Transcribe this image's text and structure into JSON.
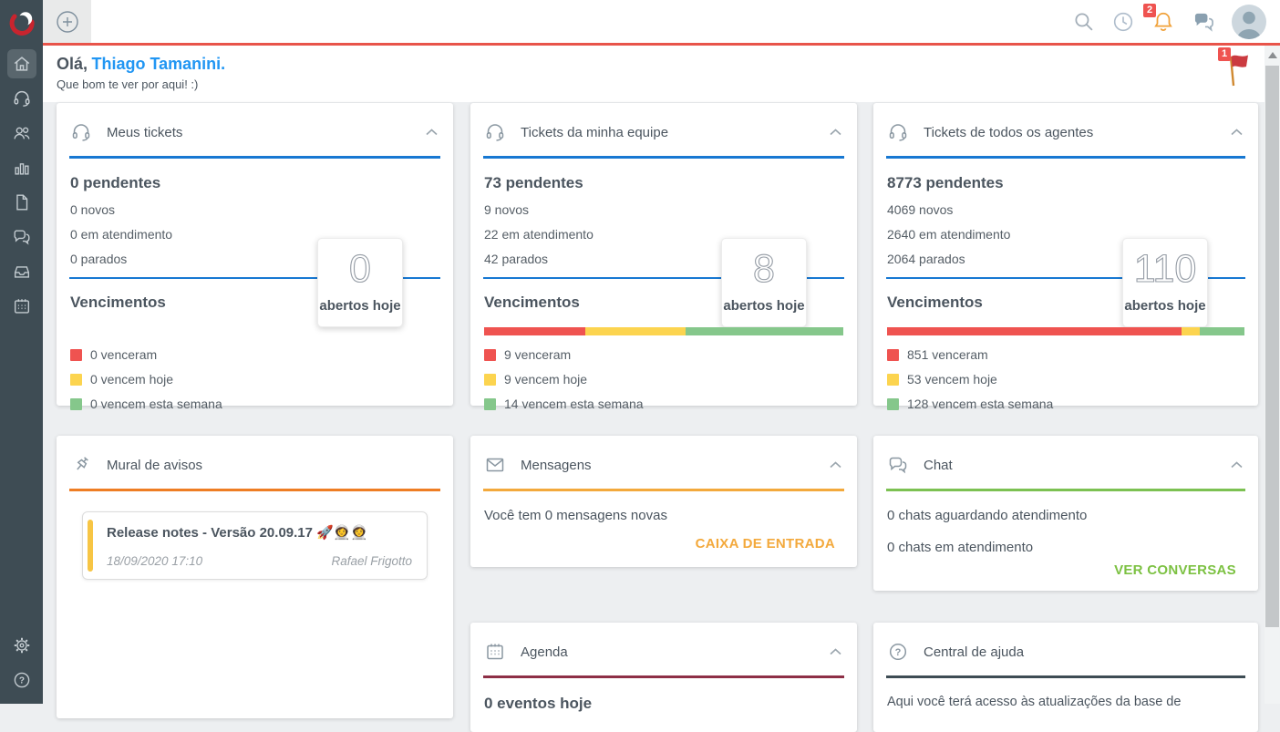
{
  "colors": {
    "accent_line": "#e8544a",
    "ticket_blue": "#1778d2",
    "mural_orange": "#ee7d23",
    "mensagens_amber": "#f3a93c",
    "chat_green": "#7cc152",
    "agenda_maroon": "#8e2f46",
    "ajuda_slate": "#3e4c54",
    "bar_red": "#ef5350",
    "bar_yellow": "#fcd44f",
    "bar_green": "#85c78b"
  },
  "icons": {
    "topbar": [
      "search-icon",
      "clock-icon",
      "bell-icon",
      "chat-icon",
      "avatar"
    ],
    "sidebar": [
      "home-icon",
      "headset-icon",
      "people-icon",
      "bar-chart-icon",
      "document-icon",
      "chat-bubbles-icon",
      "inbox-icon",
      "calendar-icon",
      "gear-icon",
      "help-icon"
    ],
    "question_glyph": "?"
  },
  "topbar": {
    "bell_badge": "2",
    "flag_badge": "1"
  },
  "greeting": {
    "hello": "Olá,",
    "name": "Thiago Tamanini.",
    "subtitle": "Que bom te ver por aqui! :)"
  },
  "tickets": [
    {
      "title": "Meus tickets",
      "accent": "#1778d2",
      "pendentes": "0 pendentes",
      "novos": "0 novos",
      "em_atendimento": "0 em atendimento",
      "parados": "0 parados",
      "abertos_value": "0",
      "abertos_label": "abertos hoje",
      "vencimentos_title": "Vencimentos",
      "bar": [
        {
          "color": "#ef5350",
          "pct": 0
        },
        {
          "color": "#fcd44f",
          "pct": 0
        },
        {
          "color": "#85c78b",
          "pct": 0
        }
      ],
      "legend": [
        {
          "color": "#ef5350",
          "label": "0 venceram"
        },
        {
          "color": "#fcd44f",
          "label": "0 vencem hoje"
        },
        {
          "color": "#85c78b",
          "label": "0 vencem esta semana"
        }
      ]
    },
    {
      "title": "Tickets da minha equipe",
      "accent": "#1778d2",
      "pendentes": "73 pendentes",
      "novos": "9 novos",
      "em_atendimento": "22 em atendimento",
      "parados": "42 parados",
      "abertos_value": "8",
      "abertos_label": "abertos hoje",
      "vencimentos_title": "Vencimentos",
      "bar": [
        {
          "color": "#ef5350",
          "pct": 28.1
        },
        {
          "color": "#fcd44f",
          "pct": 28.1
        },
        {
          "color": "#85c78b",
          "pct": 43.8
        }
      ],
      "legend": [
        {
          "color": "#ef5350",
          "label": "9 venceram"
        },
        {
          "color": "#fcd44f",
          "label": "9 vencem hoje"
        },
        {
          "color": "#85c78b",
          "label": "14 vencem esta semana"
        }
      ]
    },
    {
      "title": "Tickets de todos os agentes",
      "accent": "#1778d2",
      "pendentes": "8773 pendentes",
      "novos": "4069 novos",
      "em_atendimento": "2640 em atendimento",
      "parados": "2064 parados",
      "abertos_value": "110",
      "abertos_label": "abertos hoje",
      "vencimentos_title": "Vencimentos",
      "bar": [
        {
          "color": "#ef5350",
          "pct": 82.5
        },
        {
          "color": "#fcd44f",
          "pct": 5.1
        },
        {
          "color": "#85c78b",
          "pct": 12.4
        }
      ],
      "legend": [
        {
          "color": "#ef5350",
          "label": "851 venceram"
        },
        {
          "color": "#fcd44f",
          "label": "53 vencem hoje"
        },
        {
          "color": "#85c78b",
          "label": "128 vencem esta semana"
        }
      ]
    }
  ],
  "mural": {
    "title": "Mural de avisos",
    "accent": "#ee7d23",
    "note": {
      "title": "Release notes - Versão 20.09.17 🚀👩‍🚀👩‍🚀",
      "date": "18/09/2020 17:10",
      "author": "Rafael Frigotto"
    }
  },
  "mensagens": {
    "title": "Mensagens",
    "accent": "#f3a93c",
    "body": "Você tem 0 mensagens novas",
    "link": "CAIXA DE ENTRADA"
  },
  "chat": {
    "title": "Chat",
    "accent": "#7cc152",
    "line1": "0 chats aguardando atendimento",
    "line2": "0 chats em atendimento",
    "link": "VER CONVERSAS"
  },
  "agenda": {
    "title": "Agenda",
    "accent": "#8e2f46",
    "line1": "0 eventos hoje"
  },
  "ajuda": {
    "title": "Central de ajuda",
    "accent": "#3e4c54",
    "line1": "Aqui você terá acesso às atualizações da base de"
  }
}
